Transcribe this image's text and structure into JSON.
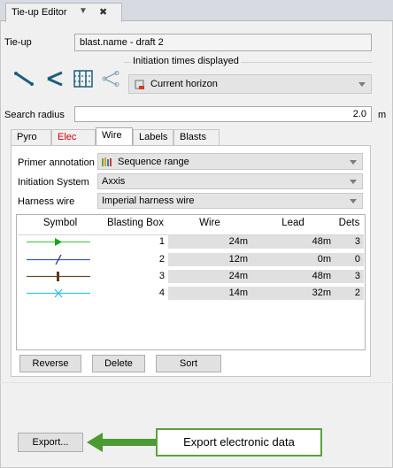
{
  "tab": {
    "title": "Tie-up Editor",
    "dropdown_glyph": "▼",
    "close_glyph": "✖"
  },
  "tieup": {
    "label": "Tie-up",
    "value": "blast.name - draft 2"
  },
  "initiation": {
    "group_label": "Initiation times displayed",
    "value": "Current horizon"
  },
  "search": {
    "label": "Search radius",
    "value": "2.0",
    "unit": "m"
  },
  "tabs": [
    {
      "label": "Pyro"
    },
    {
      "label": "Elec"
    },
    {
      "label": "Wire"
    },
    {
      "label": "Labels"
    },
    {
      "label": "Blasts"
    }
  ],
  "form": {
    "primer_label": "Primer annotation",
    "primer_value": "Sequence range",
    "system_label": "Initiation System",
    "system_value": "Axxis",
    "harness_label": "Harness wire",
    "harness_value": "Imperial harness wire"
  },
  "table": {
    "headers": [
      "Symbol",
      "Blasting Box",
      "Wire",
      "Lead",
      "Dets"
    ],
    "rows": [
      {
        "box": "1",
        "wire": "24m",
        "lead": "48m",
        "dets": "3",
        "symbol": "green-arrow"
      },
      {
        "box": "2",
        "wire": "12m",
        "lead": "0m",
        "dets": "0",
        "symbol": "blue-slash"
      },
      {
        "box": "3",
        "wire": "24m",
        "lead": "48m",
        "dets": "3",
        "symbol": "brown-bar"
      },
      {
        "box": "4",
        "wire": "14m",
        "lead": "32m",
        "dets": "2",
        "symbol": "cyan-x"
      }
    ]
  },
  "buttons": {
    "reverse": "Reverse",
    "delete": "Delete",
    "sort": "Sort",
    "export": "Export..."
  },
  "annotation": "Export electronic data",
  "colors": {
    "elec_tab": "#d40000",
    "arrow": "#4b9a32"
  }
}
